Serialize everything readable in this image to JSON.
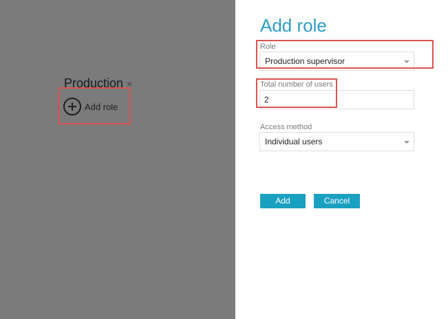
{
  "background_group": {
    "title": "Production",
    "close_glyph": "×",
    "add_role_label": "Add role"
  },
  "dialog": {
    "title": "Add role",
    "role": {
      "label": "Role",
      "value": "Production supervisor"
    },
    "total_users": {
      "label": "Total number of users",
      "value": "2"
    },
    "access_method": {
      "label": "Access method",
      "value": "Individual users"
    },
    "add_button": "Add",
    "cancel_button": "Cancel"
  },
  "colors": {
    "overlay": "#7b7b7b",
    "accent": "#1aa0c0",
    "title": "#2d9ec2",
    "highlight": "#d9534f"
  }
}
